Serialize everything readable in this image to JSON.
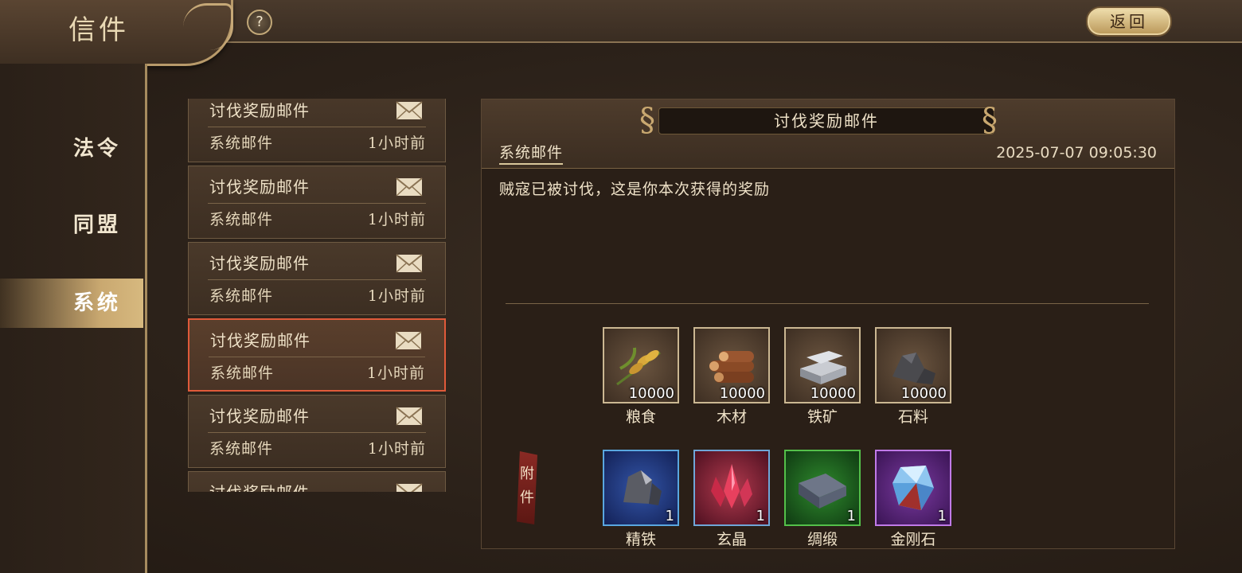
{
  "header": {
    "title": "信件",
    "help_label": "?",
    "back_label": "返回"
  },
  "nav": {
    "items": [
      {
        "label": "法令",
        "active": false
      },
      {
        "label": "同盟",
        "active": false
      },
      {
        "label": "系统",
        "active": true
      }
    ]
  },
  "mail_list": {
    "items": [
      {
        "title": "讨伐奖励邮件",
        "sender": "系统邮件",
        "time": "1小时前",
        "selected": false
      },
      {
        "title": "讨伐奖励邮件",
        "sender": "系统邮件",
        "time": "1小时前",
        "selected": false
      },
      {
        "title": "讨伐奖励邮件",
        "sender": "系统邮件",
        "time": "1小时前",
        "selected": false
      },
      {
        "title": "讨伐奖励邮件",
        "sender": "系统邮件",
        "time": "1小时前",
        "selected": true
      },
      {
        "title": "讨伐奖励邮件",
        "sender": "系统邮件",
        "time": "1小时前",
        "selected": false
      },
      {
        "title": "讨伐奖励邮件",
        "sender": "",
        "time": "",
        "selected": false
      }
    ]
  },
  "detail": {
    "title": "讨伐奖励邮件",
    "sender": "系统邮件",
    "timestamp": "2025-07-07 09:05:30",
    "body": "贼寇已被讨伐，这是你本次获得的奖励",
    "attachment_label": "附件",
    "attachments": [
      {
        "name": "粮食",
        "count": "10000",
        "icon": "grain-icon",
        "rarity": "plain"
      },
      {
        "name": "木材",
        "count": "10000",
        "icon": "wood-icon",
        "rarity": "plain"
      },
      {
        "name": "铁矿",
        "count": "10000",
        "icon": "iron-ore-icon",
        "rarity": "plain"
      },
      {
        "name": "石料",
        "count": "10000",
        "icon": "stone-icon",
        "rarity": "plain"
      },
      {
        "name": "精铁",
        "count": "1",
        "icon": "refined-iron-icon",
        "rarity": "blue"
      },
      {
        "name": "玄晶",
        "count": "1",
        "icon": "crystal-icon",
        "rarity": "red"
      },
      {
        "name": "绸缎",
        "count": "1",
        "icon": "silk-icon",
        "rarity": "green"
      },
      {
        "name": "金刚石",
        "count": "1",
        "icon": "diamond-icon",
        "rarity": "purple"
      }
    ]
  },
  "colors": {
    "accent_gold": "#c9a870",
    "selected_border": "#e05a3a"
  }
}
